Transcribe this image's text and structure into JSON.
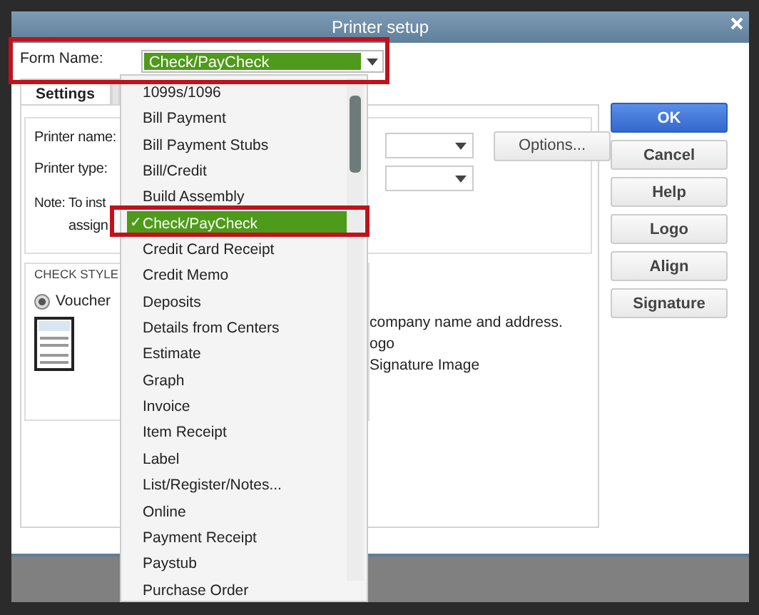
{
  "window": {
    "title": "Printer setup"
  },
  "form_name": {
    "label": "Form Name:",
    "value": "Check/PayCheck",
    "open": true,
    "selected_mark": "✓",
    "options": [
      {
        "label": "1099s/1096",
        "selected": false
      },
      {
        "label": "Bill Payment",
        "selected": false
      },
      {
        "label": "Bill Payment Stubs",
        "selected": false
      },
      {
        "label": "Bill/Credit",
        "selected": false
      },
      {
        "label": "Build Assembly",
        "selected": false
      },
      {
        "label": "Check/PayCheck",
        "selected": true
      },
      {
        "label": "Credit Card Receipt",
        "selected": false
      },
      {
        "label": "Credit Memo",
        "selected": false
      },
      {
        "label": "Deposits",
        "selected": false
      },
      {
        "label": "Details from Centers",
        "selected": false
      },
      {
        "label": "Estimate",
        "selected": false
      },
      {
        "label": "Graph",
        "selected": false
      },
      {
        "label": "Invoice",
        "selected": false
      },
      {
        "label": "Item Receipt",
        "selected": false
      },
      {
        "label": "Label",
        "selected": false
      },
      {
        "label": "List/Register/Notes...",
        "selected": false
      },
      {
        "label": "Online",
        "selected": false
      },
      {
        "label": "Payment Receipt",
        "selected": false
      },
      {
        "label": "Paystub",
        "selected": false
      },
      {
        "label": "Purchase Order",
        "selected": false
      }
    ]
  },
  "tabs": [
    {
      "label": "Settings",
      "selected": true
    }
  ],
  "settings": {
    "printer_name_label": "Printer name:",
    "printer_type_label": "Printer type:",
    "options_button": "Options...",
    "note": [
      "Note: To inst",
      "assign"
    ]
  },
  "check_style": {
    "title": "CHECK STYLE",
    "options": [
      {
        "label": "Voucher",
        "selected": true
      }
    ]
  },
  "print_options": [
    "company name and address.",
    "ogo",
    "Signature Image"
  ],
  "buttons": [
    {
      "label": "OK",
      "kind": "primary"
    },
    {
      "label": "Cancel",
      "kind": "normal"
    },
    {
      "label": "Help",
      "kind": "normal"
    },
    {
      "label": "Logo",
      "kind": "normal"
    },
    {
      "label": "Align",
      "kind": "normal"
    },
    {
      "label": "Signature",
      "kind": "normal"
    }
  ]
}
